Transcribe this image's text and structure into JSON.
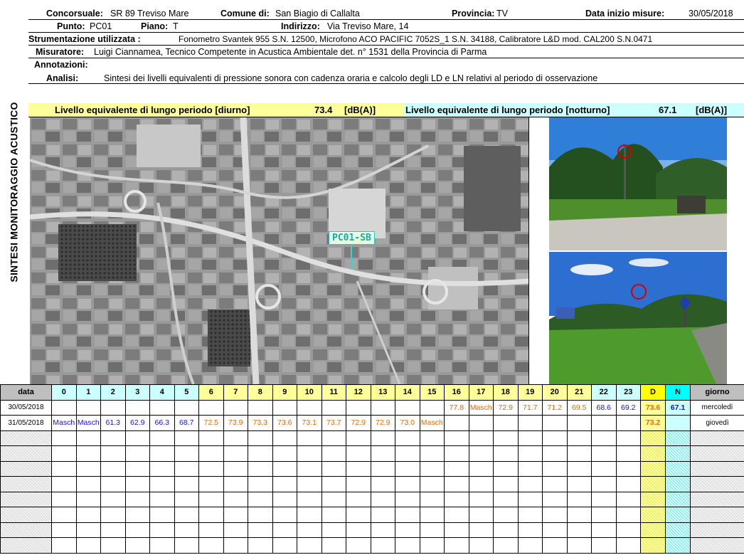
{
  "side_title": "SINTESI MONITORAGGIO ACUSTICO",
  "header": {
    "concorsuale_label": "Concorsuale:",
    "concorsuale_value": "SR 89 Treviso Mare",
    "comune_label": "Comune di:",
    "comune_value": "San Biagio di Callalta",
    "provincia_label": "Provincia:",
    "provincia_value": "TV",
    "data_label": "Data inizio misure:",
    "data_value": "30/05/2018",
    "punto_label": "Punto:",
    "punto_value": "PC01",
    "piano_label": "Piano:",
    "piano_value": "T",
    "indirizzo_label": "Indirizzo:",
    "indirizzo_value": "Via Treviso Mare, 14",
    "strumentazione_label": "Strumentazione utilizzata :",
    "strumentazione_value": "Fonometro Svantek 955 S.N. 12500, Microfono ACO PACIFIC 7052S_1 S.N. 34188, Calibratore L&D mod. CAL200 S.N.0471",
    "misuratore_label": "Misuratore:",
    "misuratore_value": "Luigi Ciannamea, Tecnico Competente in Acustica Ambientale det. n° 1531 della Provincia di Parma",
    "annotazioni_label": "Annotazioni:",
    "analisi_label": "Analisi:",
    "analisi_value": "Sintesi dei livelli equivalenti di pressione sonora con cadenza oraria e calcolo degli LD e LN relativi al periodo di osservazione"
  },
  "levels": {
    "day_label": "Livello equivalente di lungo periodo [diurno]",
    "day_value": "73.4",
    "day_unit": "[dB(A)]",
    "night_label": "Livello equivalente di lungo periodo [notturno]",
    "night_value": "67.1",
    "night_unit": "[dB(A)]"
  },
  "map": {
    "tag": "PC01-SB"
  },
  "colors": {
    "day": "#ffff99",
    "night": "#ccffff",
    "day_text": "#e36c09",
    "night_text": "#1515d6"
  },
  "table": {
    "data_header": "data",
    "hours": [
      "0",
      "1",
      "2",
      "3",
      "4",
      "5",
      "6",
      "7",
      "8",
      "9",
      "10",
      "11",
      "12",
      "13",
      "14",
      "15",
      "16",
      "17",
      "18",
      "19",
      "20",
      "21",
      "22",
      "23"
    ],
    "d_header": "D",
    "n_header": "N",
    "giorno_header": "giorno",
    "rows": [
      {
        "date": "30/05/2018",
        "values": [
          "",
          "",
          "",
          "",
          "",
          "",
          "",
          "",
          "",
          "",
          "",
          "",
          "",
          "",
          "",
          "",
          "77.8",
          "Masch",
          "72.9",
          "71.7",
          "71.2",
          "69.5",
          "68.6",
          "69.2"
        ],
        "d": "73.6",
        "n": "67.1",
        "day": "mercoledì"
      },
      {
        "date": "31/05/2018",
        "values": [
          "Masch",
          "Masch",
          "61.3",
          "62.9",
          "66.3",
          "68.7",
          "72.5",
          "73.9",
          "73.3",
          "73.6",
          "73.1",
          "73.7",
          "72.9",
          "72.9",
          "73.0",
          "Masch",
          "",
          "",
          "",
          "",
          "",
          "",
          "",
          ""
        ],
        "d": "73.2",
        "n": "",
        "day": "giovedì"
      }
    ],
    "empty_rows": 8
  }
}
